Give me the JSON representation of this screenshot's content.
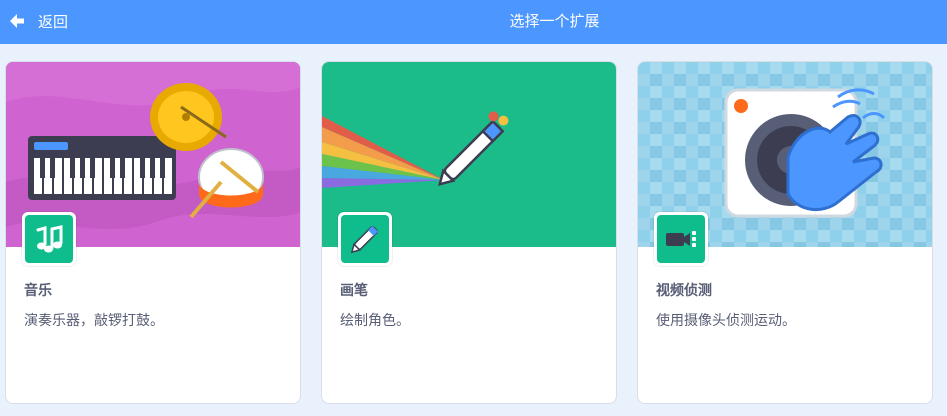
{
  "header": {
    "back_label": "返回",
    "title": "选择一个扩展"
  },
  "extensions": [
    {
      "title": "音乐",
      "description": "演奏乐器，敲锣打鼓。",
      "icon": "music-notes-icon",
      "image": "keyboard-cymbal-drum-illustration"
    },
    {
      "title": "画笔",
      "description": "绘制角色。",
      "icon": "pen-icon",
      "image": "rainbow-pen-illustration"
    },
    {
      "title": "视频侦测",
      "description": "使用摄像头侦测运动。",
      "icon": "video-camera-icon",
      "image": "camera-hand-wave-illustration"
    }
  ],
  "colors": {
    "header_bg": "#4c97ff",
    "page_bg": "#e9f1fc",
    "extension_icon_bg": "#0fbd8c",
    "music_bg": "#cf63cf",
    "pen_bg": "#0fbd8c",
    "video_bg": "#8ccbe6",
    "text": "#575e75"
  }
}
